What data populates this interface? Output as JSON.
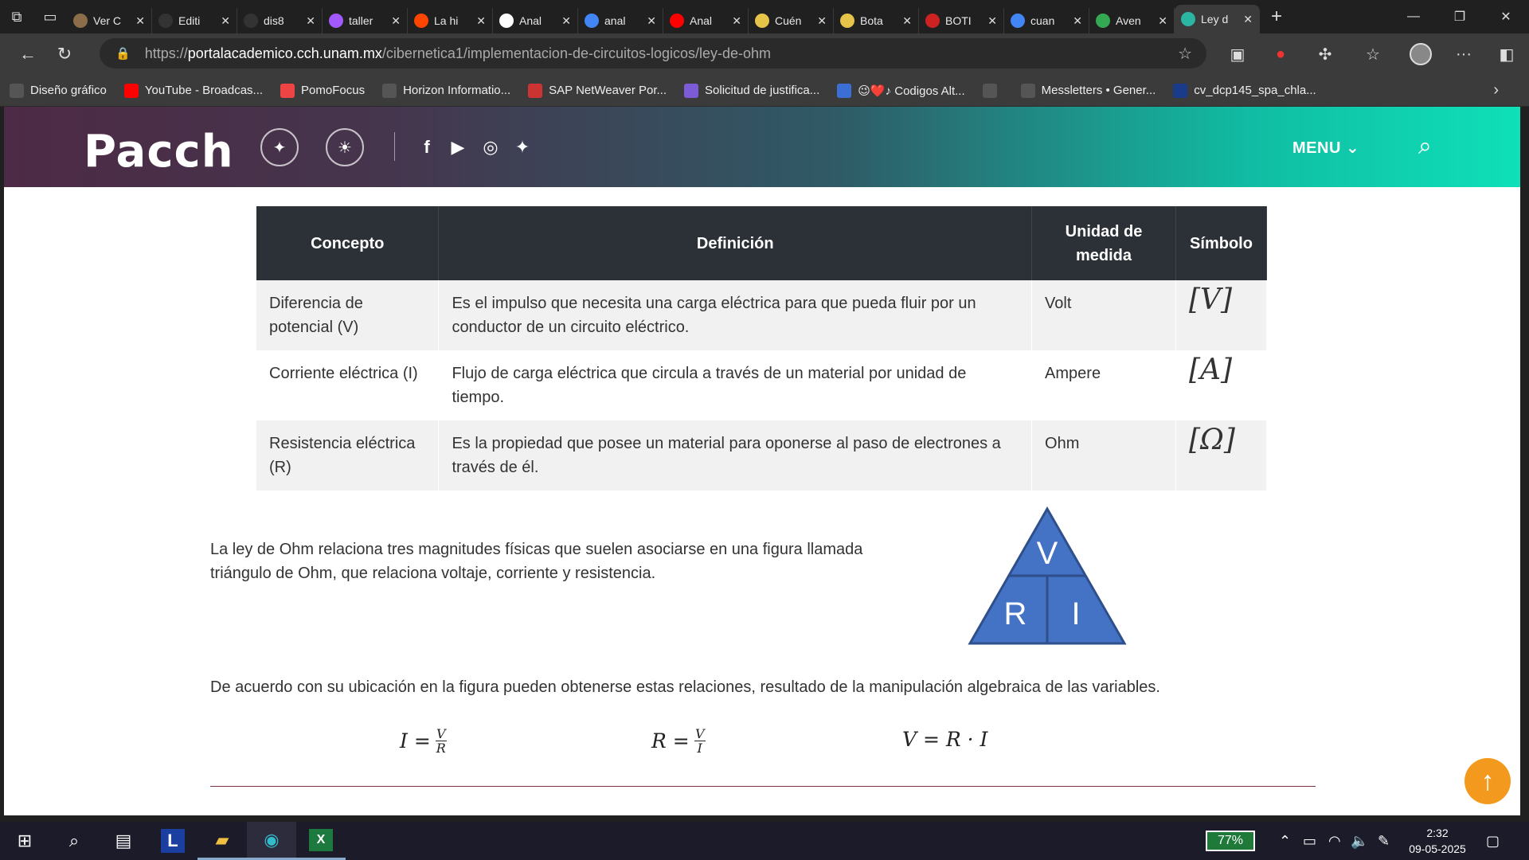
{
  "browser": {
    "tabs": [
      {
        "title": "Ver C",
        "color": "#8b6d4a"
      },
      {
        "title": "Editi",
        "color": "#333333"
      },
      {
        "title": "dis8",
        "color": "#333333"
      },
      {
        "title": "taller",
        "color": "#a259ff"
      },
      {
        "title": "La hi",
        "color": "#ff4500"
      },
      {
        "title": "Anal",
        "color": "#ffffff"
      },
      {
        "title": "anal",
        "color": "#4285f4"
      },
      {
        "title": "Anal",
        "color": "#ff0000"
      },
      {
        "title": "Cuén",
        "color": "#e6c44a"
      },
      {
        "title": "Bota",
        "color": "#e6c44a"
      },
      {
        "title": "BOTI",
        "color": "#cc2222"
      },
      {
        "title": "cuan",
        "color": "#4285f4"
      },
      {
        "title": "Aven",
        "color": "#34a853"
      },
      {
        "title": "Ley d",
        "color": "#2bb5a3"
      }
    ],
    "url_prefix": "https://",
    "url_domain": "portalacademico.cch.unam.mx",
    "url_path": "/cibernetica1/implementacion-de-circuitos-logicos/ley-de-ohm",
    "bookmarks": [
      {
        "label": "Diseño gráfico",
        "color": "#555555"
      },
      {
        "label": "YouTube - Broadcas...",
        "color": "#ff0000"
      },
      {
        "label": "PomoFocus",
        "color": "#e44"
      },
      {
        "label": "Horizon Informatio...",
        "color": "#555555"
      },
      {
        "label": "SAP NetWeaver Por...",
        "color": "#cc3333"
      },
      {
        "label": "Solicitud de justifica...",
        "color": "#7b5cd6"
      },
      {
        "label": "😉❤️♪ Codigos Alt...",
        "color": "#3b6fd6"
      },
      {
        "label": "",
        "color": "#555555"
      },
      {
        "label": "Messletters • Gener...",
        "color": "#555555"
      },
      {
        "label": "cv_dcp145_spa_chla...",
        "color": "#1a3a8a"
      }
    ]
  },
  "site": {
    "logo": "Pacch",
    "menu_label": "MENU"
  },
  "table": {
    "headers": [
      "Concepto",
      "Definición",
      "Unidad de medida",
      "Símbolo"
    ],
    "rows": [
      {
        "concept": "Diferencia de potencial (V)",
        "definition": "Es el impulso que necesita una carga eléctrica para que pueda fluir por un conductor de un circuito eléctrico.",
        "unit": "Volt",
        "symbol": "[V]"
      },
      {
        "concept": "Corriente eléctrica (I)",
        "definition": "Flujo de carga eléctrica que circula a través de un material por unidad de tiempo.",
        "unit": "Ampere",
        "symbol": "[A]"
      },
      {
        "concept": "Resistencia eléctrica (R)",
        "definition": "Es la propiedad que posee un material para oponerse al paso de electrones a través de él.",
        "unit": "Ohm",
        "symbol": "[Ω]"
      }
    ]
  },
  "content": {
    "para1_line1": "La ley de Ohm relaciona tres magnitudes físicas que suelen asociarse en una figura llamada",
    "para1_line2": "triángulo de Ohm, que relaciona voltaje, corriente y resistencia.",
    "para2": "De acuerdo con su ubicación en la figura pueden obtenerse estas relaciones, resultado de la manipulación algebraica de las variables.",
    "triangle": {
      "top": "V",
      "left": "R",
      "right": "I",
      "color": "#4472c4"
    },
    "formulas": [
      {
        "lhs": "I =",
        "num": "V",
        "den": "R"
      },
      {
        "lhs": "R =",
        "num": "V",
        "den": "I"
      },
      {
        "expr": "V = R · I"
      }
    ]
  },
  "taskbar": {
    "battery": "77%",
    "time": "2:32",
    "date": "09-05-2025"
  }
}
